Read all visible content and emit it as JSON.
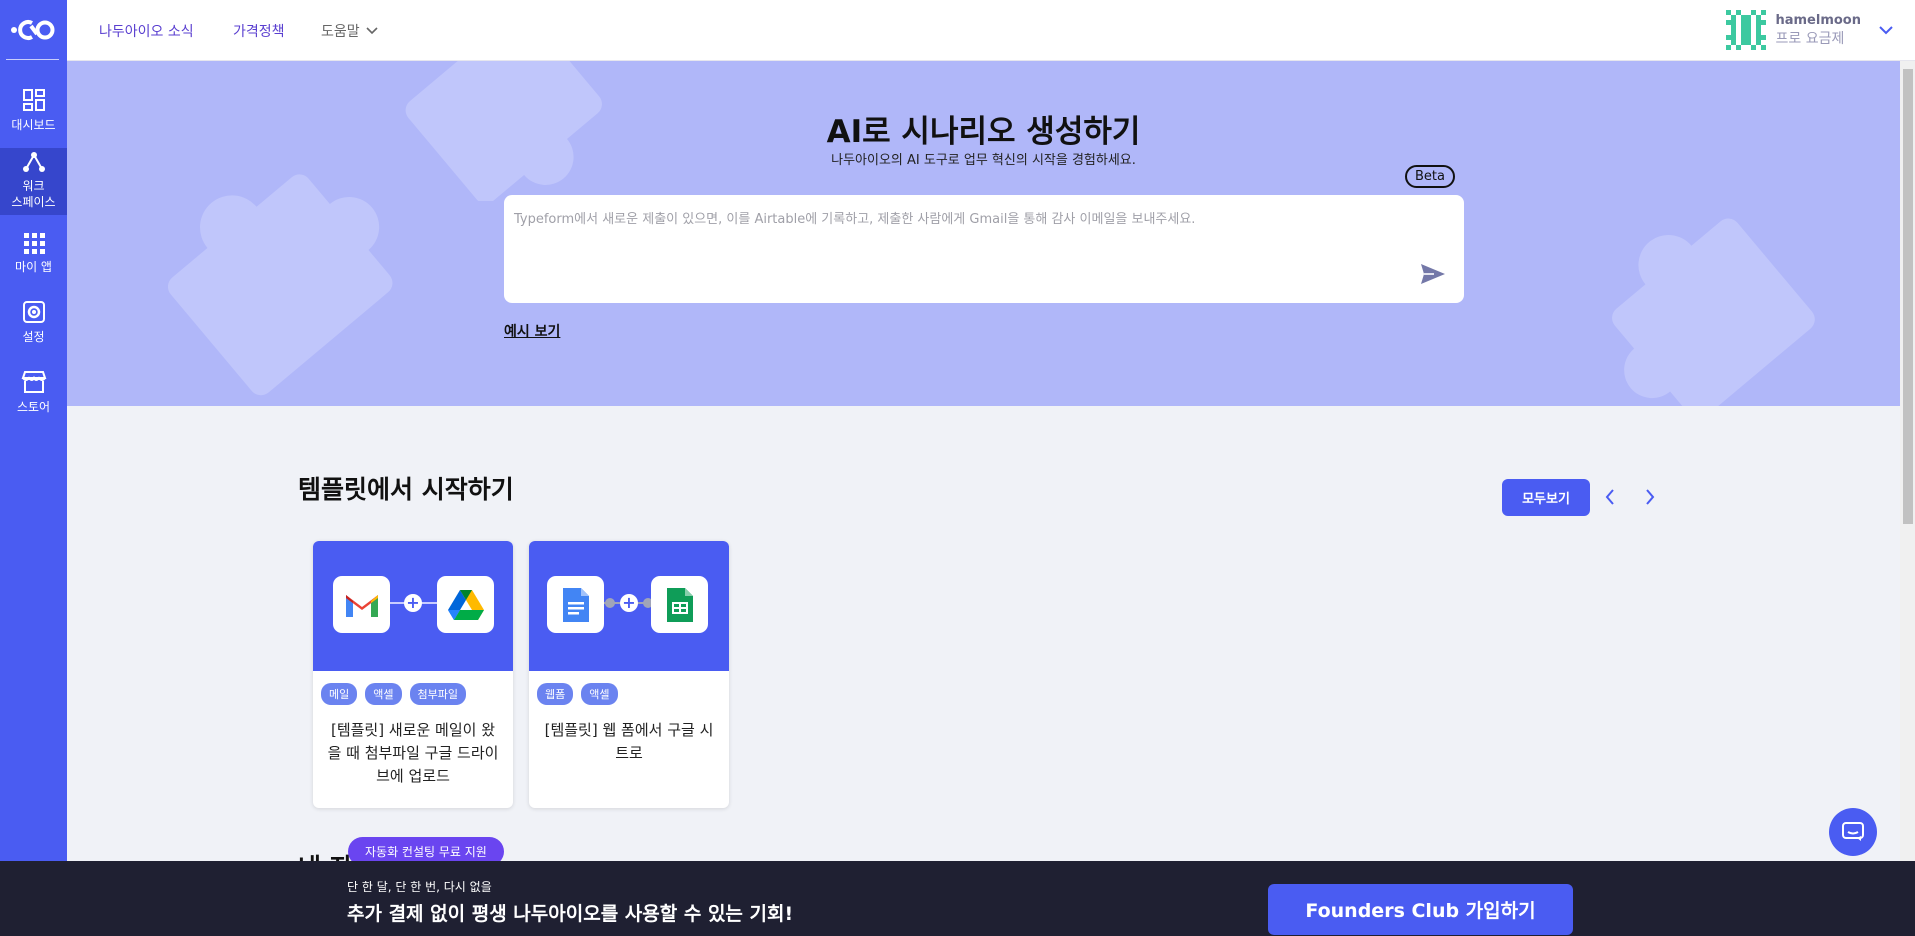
{
  "sidebar": {
    "items": [
      {
        "label": "대시보드"
      },
      {
        "label": "워크\n스페이스"
      },
      {
        "label": "마이 앱"
      },
      {
        "label": "설정"
      },
      {
        "label": "스토어"
      }
    ]
  },
  "topbar": {
    "nav": [
      "나두아이오 소식",
      "가격정책",
      "도움말"
    ],
    "user": {
      "name": "hamelmoon",
      "plan": "프로 요금제"
    }
  },
  "hero": {
    "title": "AI로 시나리오 생성하기",
    "subtitle": "나두아이오의 AI 도구로 업무 혁신의 시작을 경험하세요.",
    "badge": "Beta",
    "placeholder": "Typeform에서 새로운 제출이 있으면, 이를 Airtable에 기록하고, 제출한 사람에게 Gmail을 통해 감사 이메일을 보내주세요.",
    "example_link": "예시 보기"
  },
  "templates": {
    "title": "템플릿에서 시작하기",
    "view_all": "모두보기",
    "cards": [
      {
        "tags": [
          "메일",
          "액셀",
          "첨부파일"
        ],
        "title": "[템플릿] 새로운 메일이 왔을 때 첨부파일 구글 드라이브에 업로드",
        "apps": [
          "gmail-icon",
          "google-drive-icon"
        ]
      },
      {
        "tags": [
          "웹폼",
          "액셀"
        ],
        "title": "[템플릿] 웹 폼에서 구글 시트로",
        "apps": [
          "google-docs-icon",
          "google-sheets-icon"
        ]
      }
    ]
  },
  "my_section": {
    "partial_title": "내 자"
  },
  "promo_pill": "자동화 컨설팅 무료 지원",
  "banner": {
    "small": "단 한 달, 단 한 번, 다시 없을",
    "big": "추가 결제 없이 평생 나두아이오를 사용할 수 있는 기회!",
    "button": "Founders Club 가입하기"
  },
  "colors": {
    "primary": "#4a5cf2",
    "hero_bg": "#b0b7f9",
    "banner_bg": "#1f2032",
    "pill": "#6a45f0"
  }
}
